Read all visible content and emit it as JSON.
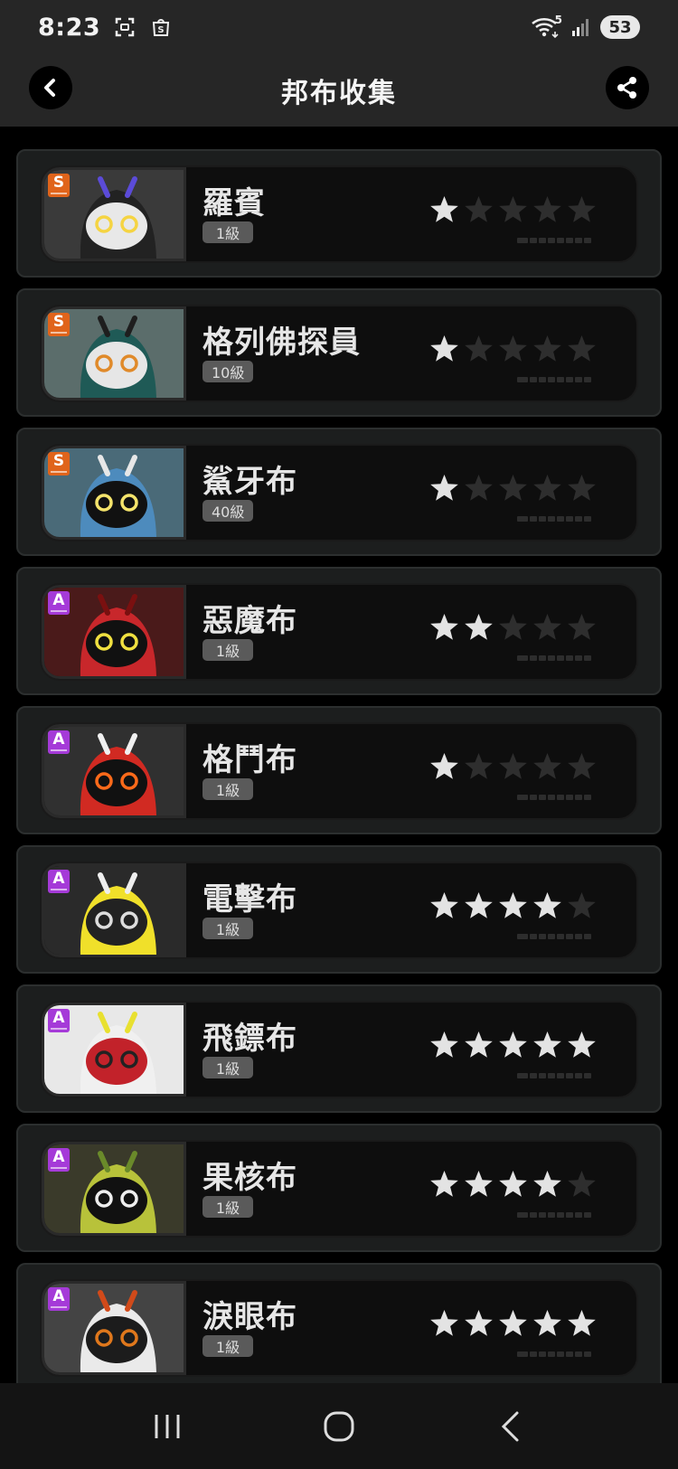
{
  "status_bar": {
    "time": "8:23",
    "wifi_badge": "5",
    "battery": "53",
    "icons": [
      "screenshot-icon",
      "shop-icon",
      "wifi-icon",
      "signal-icon",
      "battery-icon"
    ]
  },
  "header": {
    "title": "邦布收集",
    "back_icon": "chevron-left-icon",
    "share_icon": "share-icon"
  },
  "colors": {
    "grade_S": "#e0641b",
    "grade_A": "#a53ad8",
    "star_on": "#e3e3e3",
    "star_off": "#2e2e2e"
  },
  "bangboos": [
    {
      "name": "羅賓",
      "level": "1級",
      "grade": "S",
      "stars": 1,
      "max_stars": 5
    },
    {
      "name": "格列佛探員",
      "level": "10級",
      "grade": "S",
      "stars": 1,
      "max_stars": 5
    },
    {
      "name": "鯊牙布",
      "level": "40級",
      "grade": "S",
      "stars": 1,
      "max_stars": 5
    },
    {
      "name": "惡魔布",
      "level": "1級",
      "grade": "A",
      "stars": 2,
      "max_stars": 5
    },
    {
      "name": "格鬥布",
      "level": "1級",
      "grade": "A",
      "stars": 1,
      "max_stars": 5
    },
    {
      "name": "電擊布",
      "level": "1級",
      "grade": "A",
      "stars": 4,
      "max_stars": 5
    },
    {
      "name": "飛鏢布",
      "level": "1級",
      "grade": "A",
      "stars": 5,
      "max_stars": 5
    },
    {
      "name": "果核布",
      "level": "1級",
      "grade": "A",
      "stars": 4,
      "max_stars": 5
    },
    {
      "name": "淚眼布",
      "level": "1級",
      "grade": "A",
      "stars": 5,
      "max_stars": 5
    }
  ],
  "nav_bar": {
    "recent_icon": "recent-apps-icon",
    "home_icon": "home-icon",
    "back_icon": "back-icon"
  }
}
